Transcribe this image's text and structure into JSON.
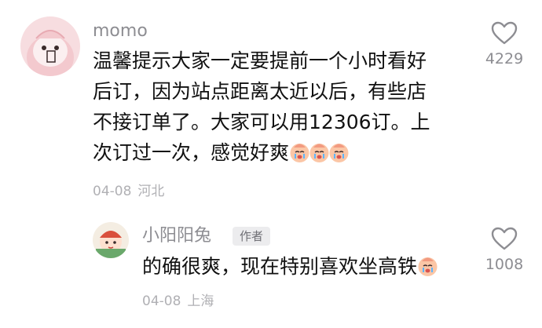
{
  "comments": [
    {
      "username": "momo",
      "lines": [
        "温馨提示大家一定要提前一个小时看好",
        "后订，因为站点距离太近以后，有些店",
        "不接订单了。大家可以用12306订。上",
        "次订过一次，感觉好爽"
      ],
      "emojis": [
        "crying-face-emoji",
        "crying-face-emoji",
        "crying-face-emoji"
      ],
      "date": "04-08",
      "location": "河北",
      "likes": "4229"
    }
  ],
  "reply": {
    "username": "小阳阳兔",
    "badge": "作者",
    "text": "的确很爽，现在特别喜欢坐高铁",
    "emojis": [
      "crying-face-emoji"
    ],
    "date": "04-08",
    "location": "上海",
    "likes": "1008"
  },
  "colors": {
    "username": "#8d8d92",
    "text": "#111111",
    "meta": "#b0b0b4",
    "badge_bg": "#ececee"
  }
}
